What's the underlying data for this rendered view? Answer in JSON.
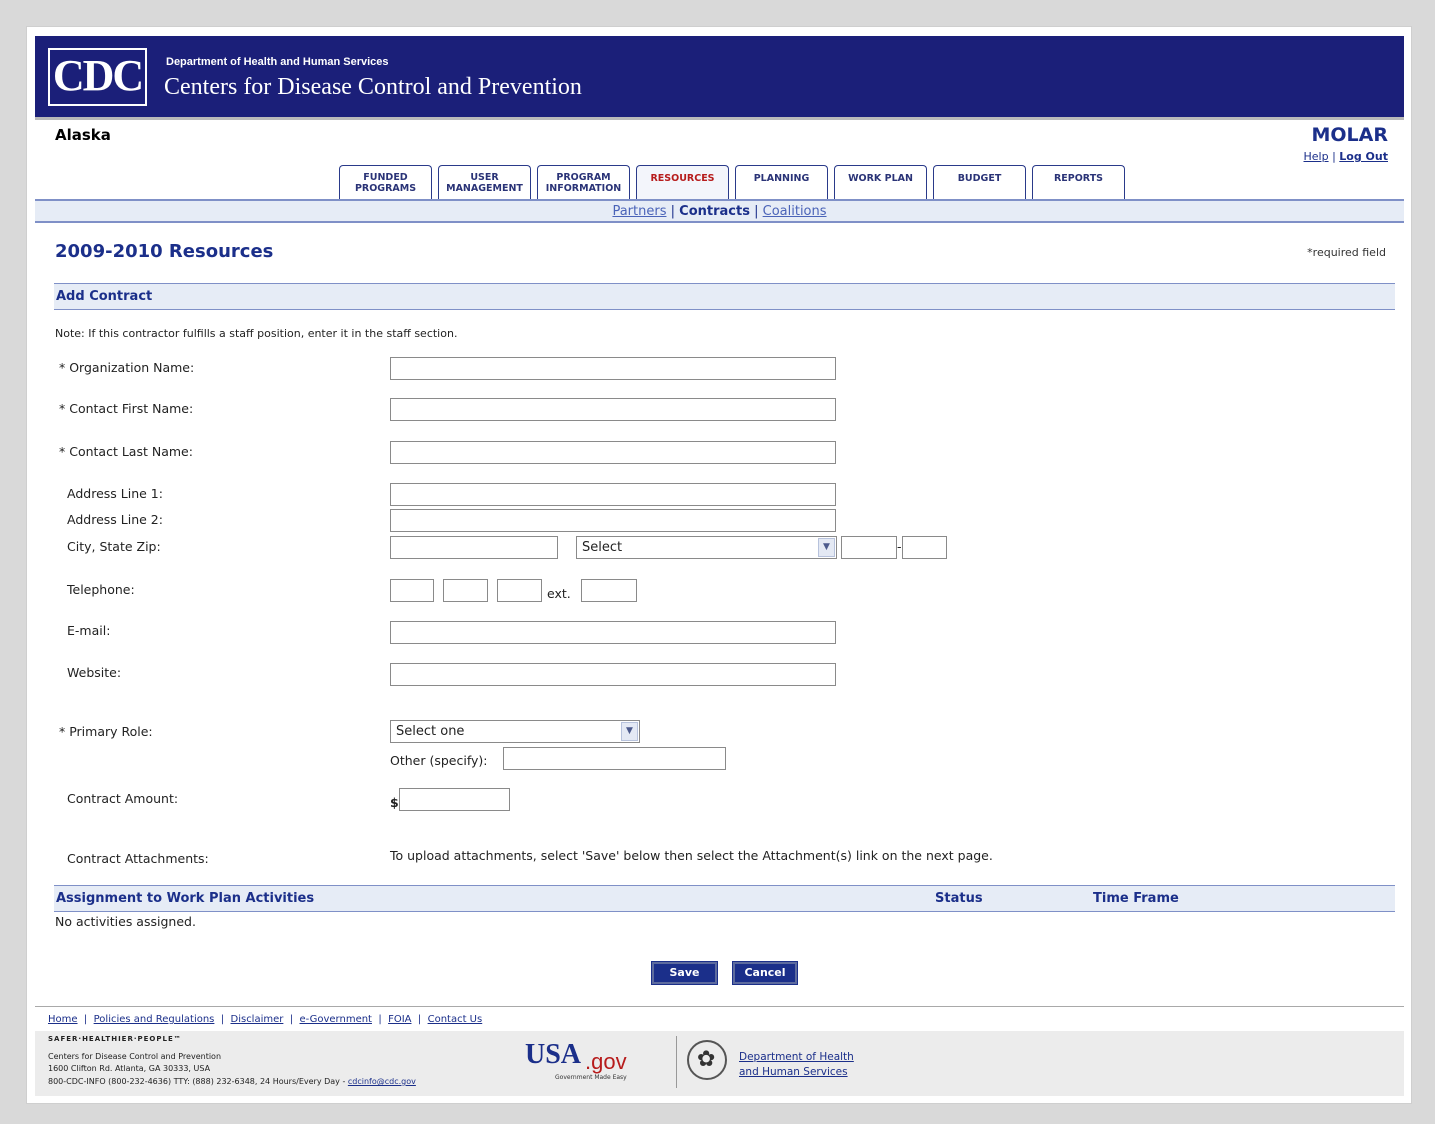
{
  "header": {
    "logo_text": "CDC",
    "department": "Department of Health and Human Services",
    "agency": "Centers for Disease Control and Prevention",
    "state": "Alaska",
    "app_name": "MOLAR",
    "help_link": "Help",
    "logout_link": "Log Out"
  },
  "tabs": [
    {
      "line1": "FUNDED",
      "line2": "PROGRAMS"
    },
    {
      "line1": "USER",
      "line2": "MANAGEMENT"
    },
    {
      "line1": "PROGRAM",
      "line2": "INFORMATION"
    },
    {
      "line1": "RESOURCES",
      "line2": ""
    },
    {
      "line1": "PLANNING",
      "line2": ""
    },
    {
      "line1": "WORK PLAN",
      "line2": ""
    },
    {
      "line1": "BUDGET",
      "line2": ""
    },
    {
      "line1": "REPORTS",
      "line2": ""
    }
  ],
  "active_tab": "RESOURCES",
  "subnav": {
    "partners": "Partners",
    "contracts": "Contracts",
    "coalitions": "Coalitions",
    "separator": "|"
  },
  "page": {
    "title": "2009-2010 Resources",
    "required_note": "*required field",
    "section_title": "Add Contract",
    "note": "Note: If this contractor fulfills a staff position, enter it in the staff section."
  },
  "form": {
    "org_name_label": "* Organization Name:",
    "first_name_label": "* Contact First Name:",
    "last_name_label": "* Contact Last Name:",
    "address1_label": "Address Line 1:",
    "address2_label": "Address Line 2:",
    "city_label": "City, State Zip:",
    "state_select": "Select",
    "zip_dash": "-",
    "phone_label": "Telephone:",
    "ext_label": "ext.",
    "email_label": "E-mail:",
    "website_label": "Website:",
    "role_label": "* Primary Role:",
    "role_select": "Select one",
    "other_label": "Other (specify):",
    "amount_label": "Contract Amount:",
    "currency": "$",
    "attachments_label": "Contract Attachments:",
    "attachments_text": "To upload attachments, select 'Save' below then select the Attachment(s) link on the next page."
  },
  "assignments": {
    "title": "Assignment to Work Plan Activities",
    "status_header": "Status",
    "timeframe_header": "Time Frame",
    "empty_text": "No activities assigned."
  },
  "buttons": {
    "save": "Save",
    "cancel": "Cancel"
  },
  "footer": {
    "links": [
      "Home",
      "Policies and Regulations",
      "Disclaimer",
      "e-Government",
      "FOIA",
      "Contact Us"
    ],
    "tagline": "SAFER·HEALTHIER·PEOPLE™",
    "address_line1": "Centers for Disease Control and Prevention",
    "address_line2": "1600 Clifton Rd. Atlanta, GA 30333, USA",
    "address_line3": "800-CDC-INFO (800-232-4636) TTY: (888) 232-6348, 24 Hours/Every Day - ",
    "email": "cdcinfo@cdc.gov",
    "usagov_main": "USA",
    "usagov_suffix": ".gov",
    "usagov_slogan": "Government Made Easy",
    "hhs_line1": "Department of Health",
    "hhs_line2": "and Human Services"
  }
}
